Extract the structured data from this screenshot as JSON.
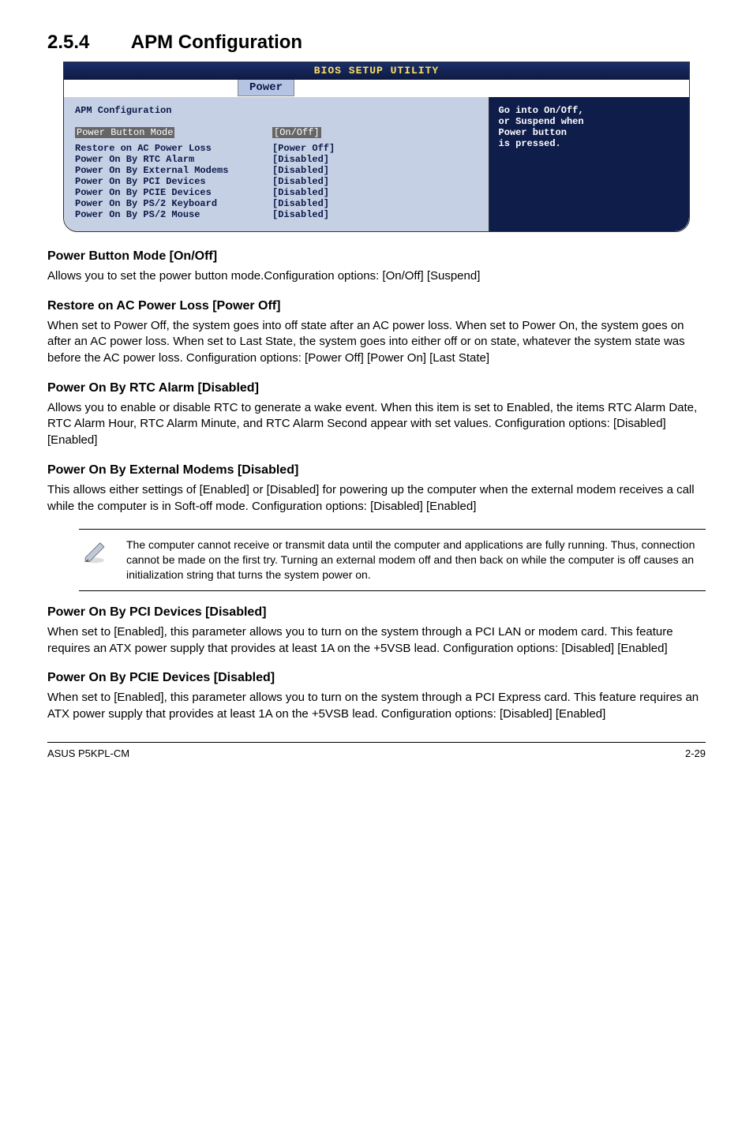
{
  "heading": {
    "num": "2.5.4",
    "title": "APM Configuration"
  },
  "bios": {
    "header": "BIOS SETUP UTILITY",
    "tab": "Power",
    "left": {
      "title": "APM Configuration",
      "highlight_label": "Power Button Mode",
      "highlight_value": "[On/Off]",
      "rows": [
        {
          "label": "Restore on AC Power Loss",
          "value": "[Power Off]"
        },
        {
          "label": "Power On By RTC Alarm",
          "value": "[Disabled]"
        },
        {
          "label": "Power On By External Modems",
          "value": "[Disabled]"
        },
        {
          "label": "Power On By PCI Devices",
          "value": "[Disabled]"
        },
        {
          "label": "Power On By PCIE Devices",
          "value": "[Disabled]"
        },
        {
          "label": "Power On By PS/2 Keyboard",
          "value": "[Disabled]"
        },
        {
          "label": "Power On By PS/2 Mouse",
          "value": "[Disabled]"
        }
      ]
    },
    "right": "Go into On/Off, or Suspend when Power button is pressed."
  },
  "sections": [
    {
      "title": "Power Button Mode [On/Off]",
      "body": "Allows you to set the power button mode.Configuration options: [On/Off] [Suspend]"
    },
    {
      "title": "Restore on AC Power Loss [Power Off]",
      "body": "When set to Power Off, the system goes into off state after an AC power loss. When set to Power On, the system goes on after an AC power loss. When set to Last State, the system goes into either off or on state, whatever the system state was before the AC power loss. Configuration options: [Power Off] [Power On] [Last State]"
    },
    {
      "title": "Power On By RTC Alarm [Disabled]",
      "body": "Allows you to enable or disable RTC to generate a wake event. When this item is set to Enabled, the items RTC Alarm Date, RTC Alarm Hour, RTC Alarm Minute, and RTC Alarm Second appear with set values. Configuration options: [Disabled] [Enabled]"
    },
    {
      "title": "Power On By External Modems [Disabled]",
      "body": "This allows either settings of [Enabled] or [Disabled] for powering up the computer when the external modem receives a call while the computer is in Soft-off mode. Configuration options: [Disabled] [Enabled]"
    }
  ],
  "note": "The computer cannot receive or transmit data until the computer and applications are fully running. Thus, connection cannot be made on the first try. Turning an external modem off and then back on while the computer is off causes an initialization string that turns the system power on.",
  "sections2": [
    {
      "title": "Power On By PCI Devices [Disabled]",
      "body": "When set to [Enabled], this parameter allows you to turn on the system through a PCI LAN or modem card. This feature requires an ATX power supply that provides at least 1A on the +5VSB lead. Configuration options: [Disabled] [Enabled]"
    },
    {
      "title": "Power On By PCIE Devices [Disabled]",
      "body": "When set to [Enabled], this parameter allows you to turn on the system through a PCI Express card. This feature requires an ATX power supply that provides at least 1A on the +5VSB lead.  Configuration options: [Disabled] [Enabled]"
    }
  ],
  "footer": {
    "left": "ASUS P5KPL-CM",
    "right": "2-29"
  }
}
